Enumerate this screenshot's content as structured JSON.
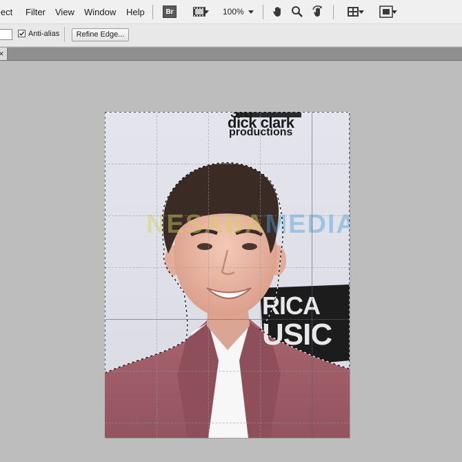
{
  "menu": {
    "select_partial": "lect",
    "filter": "Filter",
    "view": "View",
    "window": "Window",
    "help": "Help"
  },
  "toolbar": {
    "bridge_label": "Br",
    "zoom_level": "100%"
  },
  "options": {
    "feather_value": "",
    "antialias_label": "Anti-alias",
    "antialias_checked": true,
    "refine_edge_label": "Refine Edge..."
  },
  "tab": {
    "close_glyph": "×"
  },
  "photo": {
    "backdrop_text_top": "ЭIU",
    "backdrop_text_line1": "dick clark",
    "backdrop_text_line2": "productions",
    "watermark_left": "NESABA",
    "watermark_right": "MEDIA",
    "backdrop_right_1": "RICA",
    "backdrop_right_2": "USIC"
  },
  "colors": {
    "menubar_bg": "#f0f0f0",
    "canvas_bg": "#bdbdbd",
    "tabbar_bg": "#8f8f8f",
    "suit": "#9c5e68",
    "backdrop": "#e2e3ea"
  }
}
